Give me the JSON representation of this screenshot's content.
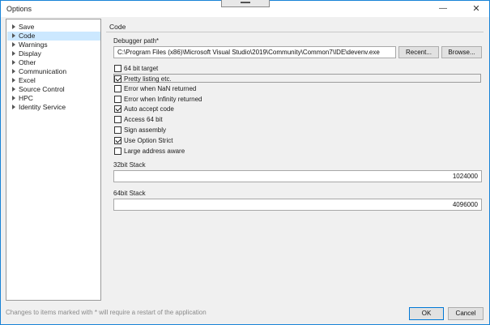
{
  "window": {
    "title": "Options",
    "minimize_label": "—",
    "close_label": "✕",
    "grip_label": "▬▬"
  },
  "sidebar": {
    "items": [
      {
        "label": "Save",
        "selected": false
      },
      {
        "label": "Code",
        "selected": true
      },
      {
        "label": "Warnings",
        "selected": false
      },
      {
        "label": "Display",
        "selected": false
      },
      {
        "label": "Other",
        "selected": false
      },
      {
        "label": "Communication",
        "selected": false
      },
      {
        "label": "Excel",
        "selected": false
      },
      {
        "label": "Source Control",
        "selected": false
      },
      {
        "label": "HPC",
        "selected": false
      },
      {
        "label": "Identity Service",
        "selected": false
      }
    ]
  },
  "main": {
    "section_title": "Code",
    "debugger": {
      "label": "Debugger path*",
      "value": "C:\\Program Files (x86)\\Microsoft Visual Studio\\2019\\Community\\Common7\\IDE\\devenv.exe",
      "recent_label": "Recent...",
      "browse_label": "Browse..."
    },
    "checkboxes": [
      {
        "label": "64 bit target",
        "checked": false
      },
      {
        "label": "Pretty listing etc.",
        "checked": true
      },
      {
        "label": "Error when NaN returned",
        "checked": false
      },
      {
        "label": "Error when Infinity returned",
        "checked": false
      },
      {
        "label": "Auto accept code",
        "checked": true
      },
      {
        "label": "Access 64 bit",
        "checked": false
      },
      {
        "label": "Sign assembly",
        "checked": false
      },
      {
        "label": "Use Option Strict",
        "checked": true
      },
      {
        "label": "Large address aware",
        "checked": false
      }
    ],
    "stack32": {
      "label": "32bit Stack",
      "value": "1024000"
    },
    "stack64": {
      "label": "64bit Stack",
      "value": "4096000"
    }
  },
  "footer": {
    "note": "Changes to items marked with * will require a restart of the application",
    "ok_label": "OK",
    "cancel_label": "Cancel"
  },
  "colors": {
    "accent": "#1883d7",
    "selection": "#cce8ff",
    "ok_border": "#0078d7"
  }
}
